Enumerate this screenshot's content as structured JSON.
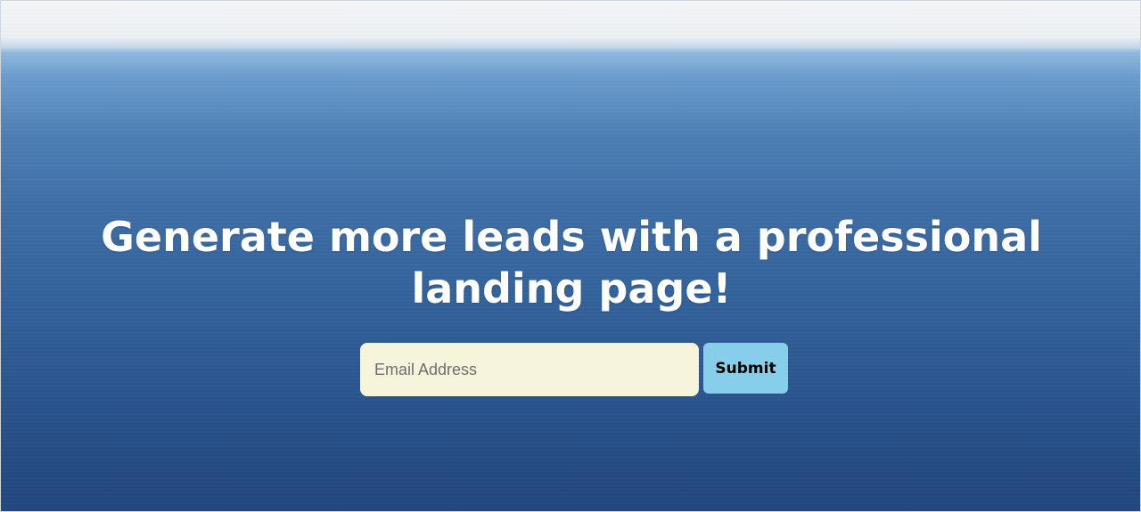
{
  "hero": {
    "headline": "Generate more leads with a professional landing page!"
  },
  "form": {
    "email_placeholder": "Email Address",
    "submit_label": "Submit"
  },
  "colors": {
    "sky": "#f4f6f8",
    "ocean_top": "#8fb9df",
    "ocean_bottom": "#22477f",
    "input_background": "#f6f5dc",
    "button_background": "#87ceeb",
    "headline_text": "#ffffff"
  }
}
